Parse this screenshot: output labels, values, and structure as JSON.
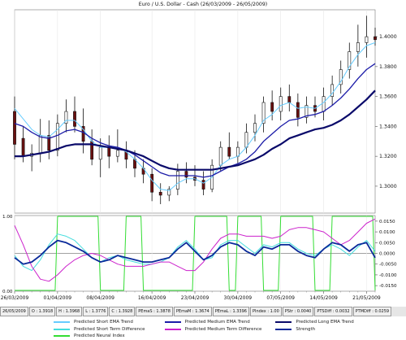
{
  "chart_data": [
    {
      "type": "line",
      "title": "Euro / U.S. Dollar -  Cash     (26/03/2009 - 26/05/2009)",
      "y_tick_labels": [
        "1.3000",
        "1.3200",
        "1.3400",
        "1.3600",
        "1.3800",
        "1.4000"
      ],
      "y_ticks": [
        1.3,
        1.32,
        1.34,
        1.36,
        1.38,
        1.4
      ],
      "ylim": [
        1.282,
        1.418
      ],
      "x_tick_labels": [
        "26/03/2009",
        "01/04/2009",
        "08/04/2009",
        "16/04/2009",
        "23/04/2009",
        "30/04/2009",
        "07/05/2009",
        "14/05/2009",
        "21/05/2009"
      ],
      "x_tick_index": [
        0,
        5,
        10,
        16,
        21,
        26,
        31,
        36,
        41
      ],
      "ohlc": [
        {
          "o": 1.35,
          "h": 1.36,
          "l": 1.318,
          "c": 1.328
        },
        {
          "o": 1.332,
          "h": 1.34,
          "l": 1.316,
          "c": 1.32
        },
        {
          "o": 1.32,
          "h": 1.328,
          "l": 1.31,
          "c": 1.322
        },
        {
          "o": 1.322,
          "h": 1.345,
          "l": 1.316,
          "c": 1.334
        },
        {
          "o": 1.334,
          "h": 1.344,
          "l": 1.318,
          "c": 1.324
        },
        {
          "o": 1.324,
          "h": 1.348,
          "l": 1.32,
          "c": 1.342
        },
        {
          "o": 1.342,
          "h": 1.358,
          "l": 1.336,
          "c": 1.35
        },
        {
          "o": 1.35,
          "h": 1.36,
          "l": 1.336,
          "c": 1.34
        },
        {
          "o": 1.34,
          "h": 1.352,
          "l": 1.322,
          "c": 1.33
        },
        {
          "o": 1.33,
          "h": 1.338,
          "l": 1.314,
          "c": 1.318
        },
        {
          "o": 1.318,
          "h": 1.332,
          "l": 1.306,
          "c": 1.326
        },
        {
          "o": 1.326,
          "h": 1.334,
          "l": 1.312,
          "c": 1.32
        },
        {
          "o": 1.32,
          "h": 1.338,
          "l": 1.316,
          "c": 1.324
        },
        {
          "o": 1.324,
          "h": 1.33,
          "l": 1.312,
          "c": 1.318
        },
        {
          "o": 1.318,
          "h": 1.324,
          "l": 1.306,
          "c": 1.312
        },
        {
          "o": 1.312,
          "h": 1.318,
          "l": 1.302,
          "c": 1.308
        },
        {
          "o": 1.308,
          "h": 1.312,
          "l": 1.29,
          "c": 1.296
        },
        {
          "o": 1.296,
          "h": 1.302,
          "l": 1.288,
          "c": 1.294
        },
        {
          "o": 1.294,
          "h": 1.3,
          "l": 1.29,
          "c": 1.298
        },
        {
          "o": 1.298,
          "h": 1.315,
          "l": 1.294,
          "c": 1.31
        },
        {
          "o": 1.31,
          "h": 1.316,
          "l": 1.302,
          "c": 1.306
        },
        {
          "o": 1.306,
          "h": 1.314,
          "l": 1.3,
          "c": 1.304
        },
        {
          "o": 1.304,
          "h": 1.31,
          "l": 1.294,
          "c": 1.298
        },
        {
          "o": 1.298,
          "h": 1.318,
          "l": 1.296,
          "c": 1.314
        },
        {
          "o": 1.314,
          "h": 1.33,
          "l": 1.31,
          "c": 1.326
        },
        {
          "o": 1.326,
          "h": 1.336,
          "l": 1.318,
          "c": 1.32
        },
        {
          "o": 1.32,
          "h": 1.33,
          "l": 1.314,
          "c": 1.326
        },
        {
          "o": 1.326,
          "h": 1.342,
          "l": 1.322,
          "c": 1.336
        },
        {
          "o": 1.336,
          "h": 1.348,
          "l": 1.33,
          "c": 1.342
        },
        {
          "o": 1.342,
          "h": 1.36,
          "l": 1.336,
          "c": 1.356
        },
        {
          "o": 1.356,
          "h": 1.364,
          "l": 1.344,
          "c": 1.35
        },
        {
          "o": 1.35,
          "h": 1.366,
          "l": 1.344,
          "c": 1.36
        },
        {
          "o": 1.36,
          "h": 1.368,
          "l": 1.35,
          "c": 1.356
        },
        {
          "o": 1.356,
          "h": 1.362,
          "l": 1.34,
          "c": 1.346
        },
        {
          "o": 1.346,
          "h": 1.36,
          "l": 1.342,
          "c": 1.354
        },
        {
          "o": 1.354,
          "h": 1.36,
          "l": 1.346,
          "c": 1.35
        },
        {
          "o": 1.35,
          "h": 1.366,
          "l": 1.344,
          "c": 1.36
        },
        {
          "o": 1.36,
          "h": 1.374,
          "l": 1.354,
          "c": 1.368
        },
        {
          "o": 1.368,
          "h": 1.384,
          "l": 1.362,
          "c": 1.378
        },
        {
          "o": 1.378,
          "h": 1.396,
          "l": 1.372,
          "c": 1.39
        },
        {
          "o": 1.39,
          "h": 1.408,
          "l": 1.38,
          "c": 1.396
        },
        {
          "o": 1.396,
          "h": 1.414,
          "l": 1.386,
          "c": 1.4
        },
        {
          "o": 1.4,
          "h": 1.406,
          "l": 1.394,
          "c": 1.398
        }
      ],
      "series": [
        {
          "name": "Predicted Short EMA Trend",
          "color": "#66ccff",
          "width": 1,
          "values": [
            1.352,
            1.345,
            1.338,
            1.334,
            1.333,
            1.338,
            1.344,
            1.344,
            1.338,
            1.33,
            1.326,
            1.326,
            1.326,
            1.323,
            1.318,
            1.312,
            1.304,
            1.298,
            1.297,
            1.302,
            1.305,
            1.305,
            1.302,
            1.306,
            1.314,
            1.318,
            1.32,
            1.326,
            1.334,
            1.344,
            1.348,
            1.354,
            1.356,
            1.352,
            1.353,
            1.352,
            1.356,
            1.362,
            1.37,
            1.38,
            1.388,
            1.394,
            1.396
          ]
        },
        {
          "name": "Predicted Medium EMA Trend",
          "color": "#1c1ca8",
          "width": 1.3,
          "values": [
            1.342,
            1.34,
            1.336,
            1.333,
            1.332,
            1.334,
            1.337,
            1.338,
            1.336,
            1.332,
            1.329,
            1.327,
            1.326,
            1.324,
            1.321,
            1.317,
            1.313,
            1.309,
            1.307,
            1.307,
            1.307,
            1.307,
            1.306,
            1.307,
            1.31,
            1.313,
            1.315,
            1.318,
            1.323,
            1.33,
            1.335,
            1.34,
            1.344,
            1.345,
            1.347,
            1.348,
            1.35,
            1.354,
            1.359,
            1.365,
            1.372,
            1.378,
            1.382
          ]
        },
        {
          "name": "Predicted Long EMA Trend",
          "color": "#0a0a6a",
          "width": 2.2,
          "values": [
            1.32,
            1.32,
            1.321,
            1.322,
            1.323,
            1.325,
            1.327,
            1.328,
            1.328,
            1.328,
            1.327,
            1.326,
            1.325,
            1.324,
            1.322,
            1.32,
            1.317,
            1.314,
            1.312,
            1.311,
            1.311,
            1.311,
            1.311,
            1.311,
            1.312,
            1.313,
            1.314,
            1.316,
            1.318,
            1.321,
            1.325,
            1.328,
            1.332,
            1.334,
            1.336,
            1.338,
            1.339,
            1.341,
            1.344,
            1.348,
            1.353,
            1.358,
            1.364
          ]
        }
      ]
    },
    {
      "type": "line",
      "left_tick_labels": [
        "1.00",
        "0.00"
      ],
      "right_tick_labels": [
        "0.0150",
        "0.0100",
        "0.0050",
        "0.0000",
        "-0.0050",
        "-0.0100",
        "-0.0150"
      ],
      "right_ticks": [
        0.015,
        0.01,
        0.005,
        0.0,
        -0.005,
        -0.01,
        -0.015
      ],
      "ylim": [
        -0.0176,
        0.0176
      ],
      "series": [
        {
          "name": "Predicted Neural Index",
          "color": "#33dd33",
          "width": 1,
          "axis": "left",
          "values": [
            0,
            0,
            0,
            0,
            0,
            1,
            1,
            1,
            1,
            1,
            0,
            0,
            0,
            1,
            1,
            0,
            0,
            0,
            0,
            0,
            0,
            1,
            1,
            1,
            1,
            0,
            1,
            1,
            1,
            0,
            0,
            1,
            1,
            1,
            1,
            0,
            0,
            1,
            1,
            1,
            1,
            1,
            0
          ]
        },
        {
          "name": "Predicted Short Term Difference",
          "color": "#44dddd",
          "width": 1,
          "values": [
            -0.001,
            -0.006,
            -0.008,
            -0.003,
            0.004,
            0.009,
            0.008,
            0.006,
            0.002,
            -0.002,
            -0.004,
            -0.002,
            -0.001,
            -0.003,
            -0.004,
            -0.005,
            -0.005,
            -0.004,
            -0.002,
            0.003,
            0.006,
            0.002,
            -0.003,
            -0.002,
            0.004,
            0.006,
            0.006,
            0.003,
            0.0,
            0.004,
            0.003,
            0.005,
            0.005,
            0.002,
            0.0,
            -0.001,
            0.002,
            0.004,
            0.002,
            -0.001,
            0.003,
            0.006,
            0.001
          ]
        },
        {
          "name": "Predicted Medium Term Difference",
          "color": "#cc22cc",
          "width": 1,
          "values": [
            0.013,
            0.004,
            -0.006,
            -0.012,
            -0.013,
            -0.01,
            -0.006,
            -0.003,
            -0.001,
            0.0,
            -0.001,
            -0.003,
            -0.005,
            -0.006,
            -0.006,
            -0.006,
            -0.005,
            -0.004,
            -0.004,
            -0.006,
            -0.008,
            -0.008,
            -0.004,
            0.002,
            0.007,
            0.009,
            0.009,
            0.008,
            0.008,
            0.008,
            0.007,
            0.008,
            0.011,
            0.012,
            0.012,
            0.011,
            0.01,
            0.007,
            0.004,
            0.006,
            0.01,
            0.014,
            0.016
          ]
        },
        {
          "name": "Strength",
          "color": "#0a2a9a",
          "width": 1.8,
          "values": [
            -0.002,
            -0.005,
            -0.004,
            -0.001,
            0.003,
            0.006,
            0.005,
            0.003,
            0.001,
            -0.002,
            -0.004,
            -0.003,
            -0.001,
            -0.002,
            -0.003,
            -0.004,
            -0.004,
            -0.003,
            -0.002,
            0.002,
            0.005,
            0.001,
            -0.003,
            -0.001,
            0.003,
            0.005,
            0.004,
            0.001,
            -0.001,
            0.003,
            0.002,
            0.004,
            0.004,
            0.001,
            -0.001,
            -0.002,
            0.002,
            0.005,
            0.004,
            0.001,
            0.004,
            0.005,
            -0.002
          ]
        }
      ]
    }
  ],
  "status_bar": [
    "26/05/2009",
    "O : 1.3918",
    "H : 1.3968",
    "L : 1.3776",
    "C : 1.3928",
    "PEmaS : 1.3878",
    "PEmaM : 1.3674",
    "PEmaL : 1.3396",
    "PIndex : 1.00",
    "PStr : 0.0040",
    "PTSDiff : 0.0032",
    "PTMDiff : 0.0259"
  ],
  "legend": [
    {
      "label": "Predicted Short EMA Trend",
      "color": "#66ccff"
    },
    {
      "label": "Predicted Medium EMA Trend",
      "color": "#1c1ca8"
    },
    {
      "label": "Predicted Long EMA Trend",
      "color": "#0a0a6a"
    },
    {
      "label": "Predicted Short Term Difference",
      "color": "#44dddd"
    },
    {
      "label": "Predicted Medium Term Difference",
      "color": "#cc22cc"
    },
    {
      "label": "Strength",
      "color": "#0a2a9a"
    },
    {
      "label": "Predicted Neural Index",
      "color": "#33dd33"
    }
  ]
}
